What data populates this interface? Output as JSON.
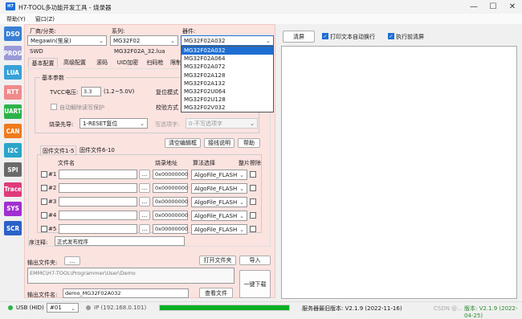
{
  "window": {
    "title": "H7-TOOL多功能开发工具 - 烧录器",
    "logo": "H7"
  },
  "menu": [
    "帮助(Y)",
    "窗口(Z)"
  ],
  "sidebar": [
    {
      "label": "DSO",
      "color": "#3a7fd5"
    },
    {
      "label": "PROG",
      "color": "#9a9ad8"
    },
    {
      "label": "LUA",
      "color": "#39a0d8"
    },
    {
      "label": "RTT",
      "color": "#f08a8a"
    },
    {
      "label": "UART",
      "color": "#2db34a"
    },
    {
      "label": "CAN",
      "color": "#f07a1e"
    },
    {
      "label": "I2C",
      "color": "#2aa5c9"
    },
    {
      "label": "SPI",
      "color": "#6a6a6a"
    },
    {
      "label": "Trace",
      "color": "#e03a7a"
    },
    {
      "label": "SYS",
      "color": "#a030d0"
    },
    {
      "label": "SCR",
      "color": "#2a62c9"
    }
  ],
  "top": {
    "vendor_label": "厂商/分类:",
    "vendor": "Megawin(笙泉)",
    "series_label": "系列:",
    "series": "MG32F02",
    "device_label": "器件:",
    "device": "MG32F02A032",
    "swd": "SWD",
    "lua": "MG32F02A_32.lua"
  },
  "dropdown": [
    "MG32F02A032",
    "MG32F02A064",
    "MG32F02A072",
    "MG32F02A128",
    "MG32F02A132",
    "MG32F02U064",
    "MG32F02U128",
    "MG32F02V032"
  ],
  "tabs": [
    "基本配置",
    "高级配置",
    "滚码",
    "UID加密",
    "扫码枪",
    "限制"
  ],
  "basic": {
    "title": "基本参数",
    "tvcc_label": "TVCC电压:",
    "tvcc": "3.3",
    "tvcc_range": "(1.2~5.0V)",
    "reset_label": "复位模式",
    "unlock": "自动解除读写保护",
    "verify_label": "校验方式",
    "prev_label": "烧录先导:",
    "prev": "1-RESET复位",
    "write_label": "写选项字:",
    "write": "0-不写选项字"
  },
  "fw": {
    "tab1": "固件文件1-5",
    "tab2": "固件文件6-10",
    "clear": "清空编辑框",
    "wiring": "接线说明",
    "help": "帮助",
    "col_file": "文件名",
    "col_addr": "烧录地址",
    "col_alg": "算法选择",
    "col_erase": "整片擦除",
    "rows": [
      {
        "n": "#1",
        "addr": "0x00000000",
        "alg": "AlgoFile_FLASH"
      },
      {
        "n": "#2",
        "addr": "0x00000000",
        "alg": "AlgoFile_FLASH"
      },
      {
        "n": "#3",
        "addr": "0x00000000",
        "alg": "AlgoFile_FLASH"
      },
      {
        "n": "#4",
        "addr": "0x00000000",
        "alg": "AlgoFile_FLASH"
      },
      {
        "n": "#5",
        "addr": "0x00000000",
        "alg": "AlgoFile_FLASH"
      }
    ],
    "browse": "..."
  },
  "note": {
    "label": "序注释:",
    "value": "正式发布程序"
  },
  "output": {
    "folder_label": "输出文件夹:",
    "browse": "...",
    "open": "打开文件夹",
    "import": "导入",
    "path": "EMMC\\H7-TOOL\\Programmer\\User\\Demo",
    "file_label": "输出文件名:",
    "file": "demo_MG32F02A032",
    "view": "查看文件",
    "download": "一键下载"
  },
  "right": {
    "clear": "清屏",
    "print_auto": "打印文本自动换行",
    "clear_before": "执行前清屏"
  },
  "status": {
    "usb": "USB (HID)",
    "port": "#01",
    "ip": "IP (192.168.0.101)",
    "progress": 1.0,
    "version": "服务器最旧版本: V2.1.9 (2022-11-16)",
    "current": "版本: V2.1.9 (2022-04-25)",
    "watermark": "CSDN @..."
  }
}
